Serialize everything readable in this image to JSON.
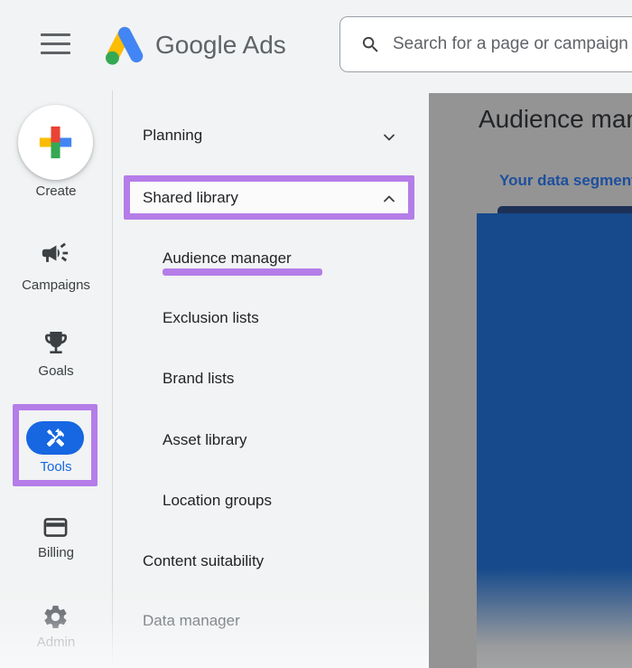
{
  "header": {
    "app_name": "Google Ads",
    "search": {
      "placeholder": "Search for a page or campaign"
    }
  },
  "left_rail": {
    "create": {
      "label": "Create",
      "icon": "multicolor-plus-icon"
    },
    "items": [
      {
        "label": "Campaigns",
        "icon": "megaphone-icon",
        "active": false
      },
      {
        "label": "Goals",
        "icon": "trophy-icon",
        "active": false
      },
      {
        "label": "Tools",
        "icon": "wrench-hammer-icon",
        "active": true,
        "annotated": true
      },
      {
        "label": "Billing",
        "icon": "credit-card-icon",
        "active": false
      },
      {
        "label": "Admin",
        "icon": "gear-icon",
        "active": false
      }
    ]
  },
  "nav_panel": {
    "items": [
      {
        "label": "Planning",
        "level": 1,
        "expanded": false
      },
      {
        "label": "Shared library",
        "level": 1,
        "expanded": true,
        "annotated": true
      },
      {
        "label": "Audience manager",
        "level": 2,
        "annotated": true
      },
      {
        "label": "Exclusion lists",
        "level": 2
      },
      {
        "label": "Brand lists",
        "level": 2
      },
      {
        "label": "Asset library",
        "level": 2
      },
      {
        "label": "Location groups",
        "level": 2
      },
      {
        "label": "Content suitability",
        "level": 1
      },
      {
        "label": "Data manager",
        "level": 1
      }
    ]
  },
  "main": {
    "page_title": "Audience manager",
    "active_tab": "Your data segments"
  },
  "annotation": {
    "highlight_color": "#b57de8"
  },
  "colors": {
    "accent_blue": "#1766e2",
    "overlay_gray": "#949494",
    "content_blue": "#164a8c",
    "tab_text_blue": "#1d4f9e",
    "google_red": "#ea4335",
    "google_yellow": "#fbbc04",
    "google_green": "#34a853",
    "google_blue": "#4285f4"
  }
}
